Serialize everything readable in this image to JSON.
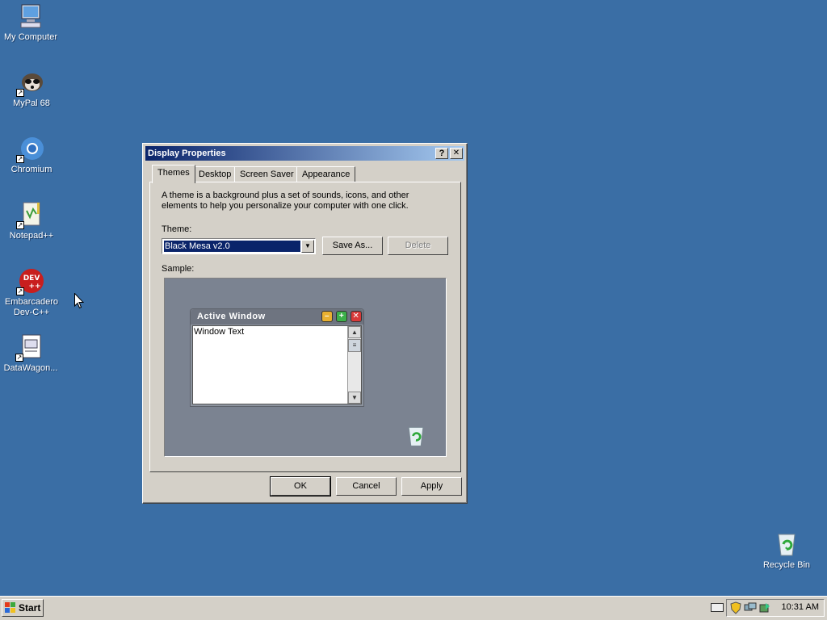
{
  "desktop": {
    "icons": [
      {
        "label": "My Computer"
      },
      {
        "label": "MyPal 68"
      },
      {
        "label": "Chromium"
      },
      {
        "label": "Notepad++"
      },
      {
        "label": "Embarcadero Dev-C++"
      },
      {
        "label": "DataWagon..."
      },
      {
        "label": "Recycle Bin"
      }
    ]
  },
  "dialog": {
    "title": "Display Properties",
    "help_btn": "?",
    "close_btn": "✕",
    "tabs": [
      {
        "label": "Themes",
        "active": true
      },
      {
        "label": "Desktop"
      },
      {
        "label": "Screen Saver"
      },
      {
        "label": "Appearance"
      }
    ],
    "description": "A theme is a background plus a set of sounds, icons, and other elements to help you personalize your computer with one click.",
    "theme_label": "Theme:",
    "theme_value": "Black Mesa v2.0",
    "save_as_label": "Save As...",
    "delete_label": "Delete",
    "sample_label": "Sample:",
    "sample": {
      "window_title": "Active Window",
      "window_text": "Window Text"
    },
    "ok_label": "OK",
    "cancel_label": "Cancel",
    "apply_label": "Apply"
  },
  "taskbar": {
    "start_label": "Start",
    "clock": "10:31 AM"
  }
}
